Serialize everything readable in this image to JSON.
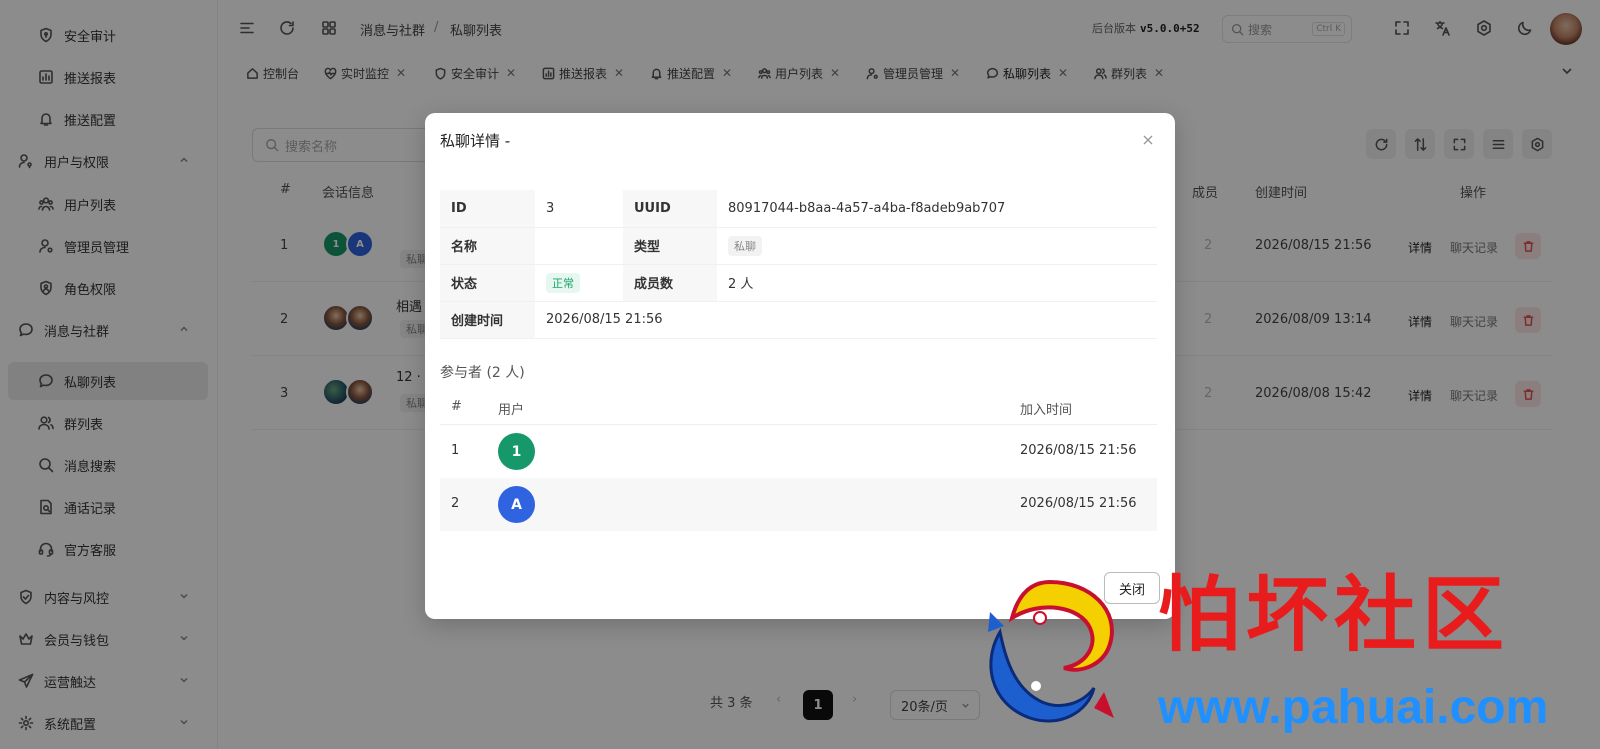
{
  "sidebar": {
    "items": [
      {
        "label": "安全审计",
        "icon": "shield-icon",
        "kind": "sub"
      },
      {
        "label": "推送报表",
        "icon": "bar-chart-icon",
        "kind": "sub"
      },
      {
        "label": "推送配置",
        "icon": "bell-icon",
        "kind": "sub"
      },
      {
        "label": "用户与权限",
        "icon": "user-key-icon",
        "kind": "group",
        "expanded": true
      },
      {
        "label": "用户列表",
        "icon": "users-icon",
        "kind": "sub"
      },
      {
        "label": "管理员管理",
        "icon": "user-cog-icon",
        "kind": "sub"
      },
      {
        "label": "角色权限",
        "icon": "shield-user-icon",
        "kind": "sub"
      },
      {
        "label": "消息与社群",
        "icon": "message-icon",
        "kind": "group",
        "expanded": true
      },
      {
        "label": "私聊列表",
        "icon": "chat-icon",
        "kind": "sub",
        "active": true
      },
      {
        "label": "群列表",
        "icon": "group-icon",
        "kind": "sub"
      },
      {
        "label": "消息搜索",
        "icon": "search-icon",
        "kind": "sub"
      },
      {
        "label": "通话记录",
        "icon": "call-log-icon",
        "kind": "sub"
      },
      {
        "label": "官方客服",
        "icon": "headset-icon",
        "kind": "sub"
      },
      {
        "label": "内容与风控",
        "icon": "shield-check-icon",
        "kind": "group",
        "expanded": false
      },
      {
        "label": "会员与钱包",
        "icon": "crown-icon",
        "kind": "group",
        "expanded": false
      },
      {
        "label": "运营触达",
        "icon": "send-icon",
        "kind": "group",
        "expanded": false
      },
      {
        "label": "系统配置",
        "icon": "gear-icon",
        "kind": "group",
        "expanded": false
      }
    ]
  },
  "header": {
    "breadcrumb": [
      "消息与社群",
      "私聊列表"
    ],
    "breadcrumb_sep": "/",
    "version_label": "后台版本",
    "version": "v5.0.0+52",
    "search_placeholder": "搜索",
    "search_kbd": "Ctrl K"
  },
  "tabs": [
    {
      "label": "控制台",
      "icon": "home-icon",
      "closable": false
    },
    {
      "label": "实时监控",
      "icon": "heart-pulse-icon",
      "closable": true
    },
    {
      "label": "安全审计",
      "icon": "shield-icon",
      "closable": true
    },
    {
      "label": "推送报表",
      "icon": "bar-chart-icon",
      "closable": true
    },
    {
      "label": "推送配置",
      "icon": "bell-icon",
      "closable": true
    },
    {
      "label": "用户列表",
      "icon": "users-icon",
      "closable": true
    },
    {
      "label": "管理员管理",
      "icon": "user-cog-icon",
      "closable": true
    },
    {
      "label": "私聊列表",
      "icon": "chat-icon",
      "closable": true,
      "active": true
    },
    {
      "label": "群列表",
      "icon": "group-icon",
      "closable": true
    }
  ],
  "main": {
    "search_placeholder": "搜索名称",
    "columns": {
      "index": "#",
      "session": "会话信息",
      "members": "成员",
      "created": "创建时间",
      "actions": "操作"
    },
    "rows": [
      {
        "index": "1",
        "title": "",
        "tag": "私聊",
        "members": "2",
        "created": "2026/08/15 21:56"
      },
      {
        "index": "2",
        "title": "相遇",
        "tag": "私聊",
        "members": "2",
        "created": "2026/08/09 13:14"
      },
      {
        "index": "3",
        "title": "12 · ",
        "tag": "私聊",
        "members": "2",
        "created": "2026/08/08 15:42"
      }
    ],
    "action_detail": "详情",
    "action_chat": "聊天记录",
    "pagination": {
      "total": "共 3 条",
      "current": "1",
      "page_size": "20条/页"
    }
  },
  "modal": {
    "title": "私聊详情 -",
    "details": {
      "id_label": "ID",
      "id": "3",
      "uuid_label": "UUID",
      "uuid": "80917044-b8aa-4a57-a4ba-f8adeb9ab707",
      "name_label": "名称",
      "name": "",
      "type_label": "类型",
      "type": "私聊",
      "status_label": "状态",
      "status": "正常",
      "members_label": "成员数",
      "members": "2 人",
      "created_label": "创建时间",
      "created": "2026/08/15 21:56"
    },
    "participants_title": "参与者 (2 人)",
    "participants_columns": {
      "index": "#",
      "user": "用户",
      "joined": "加入时间"
    },
    "participants": [
      {
        "index": "1",
        "avatar": "1",
        "color": "#16986a",
        "joined": "2026/08/15 21:56"
      },
      {
        "index": "2",
        "avatar": "A",
        "color": "#2f63e0",
        "joined": "2026/08/15 21:56"
      }
    ],
    "close_label": "关闭"
  },
  "watermark": {
    "text": "怕坏社区",
    "url": "www.pahuai.com"
  }
}
